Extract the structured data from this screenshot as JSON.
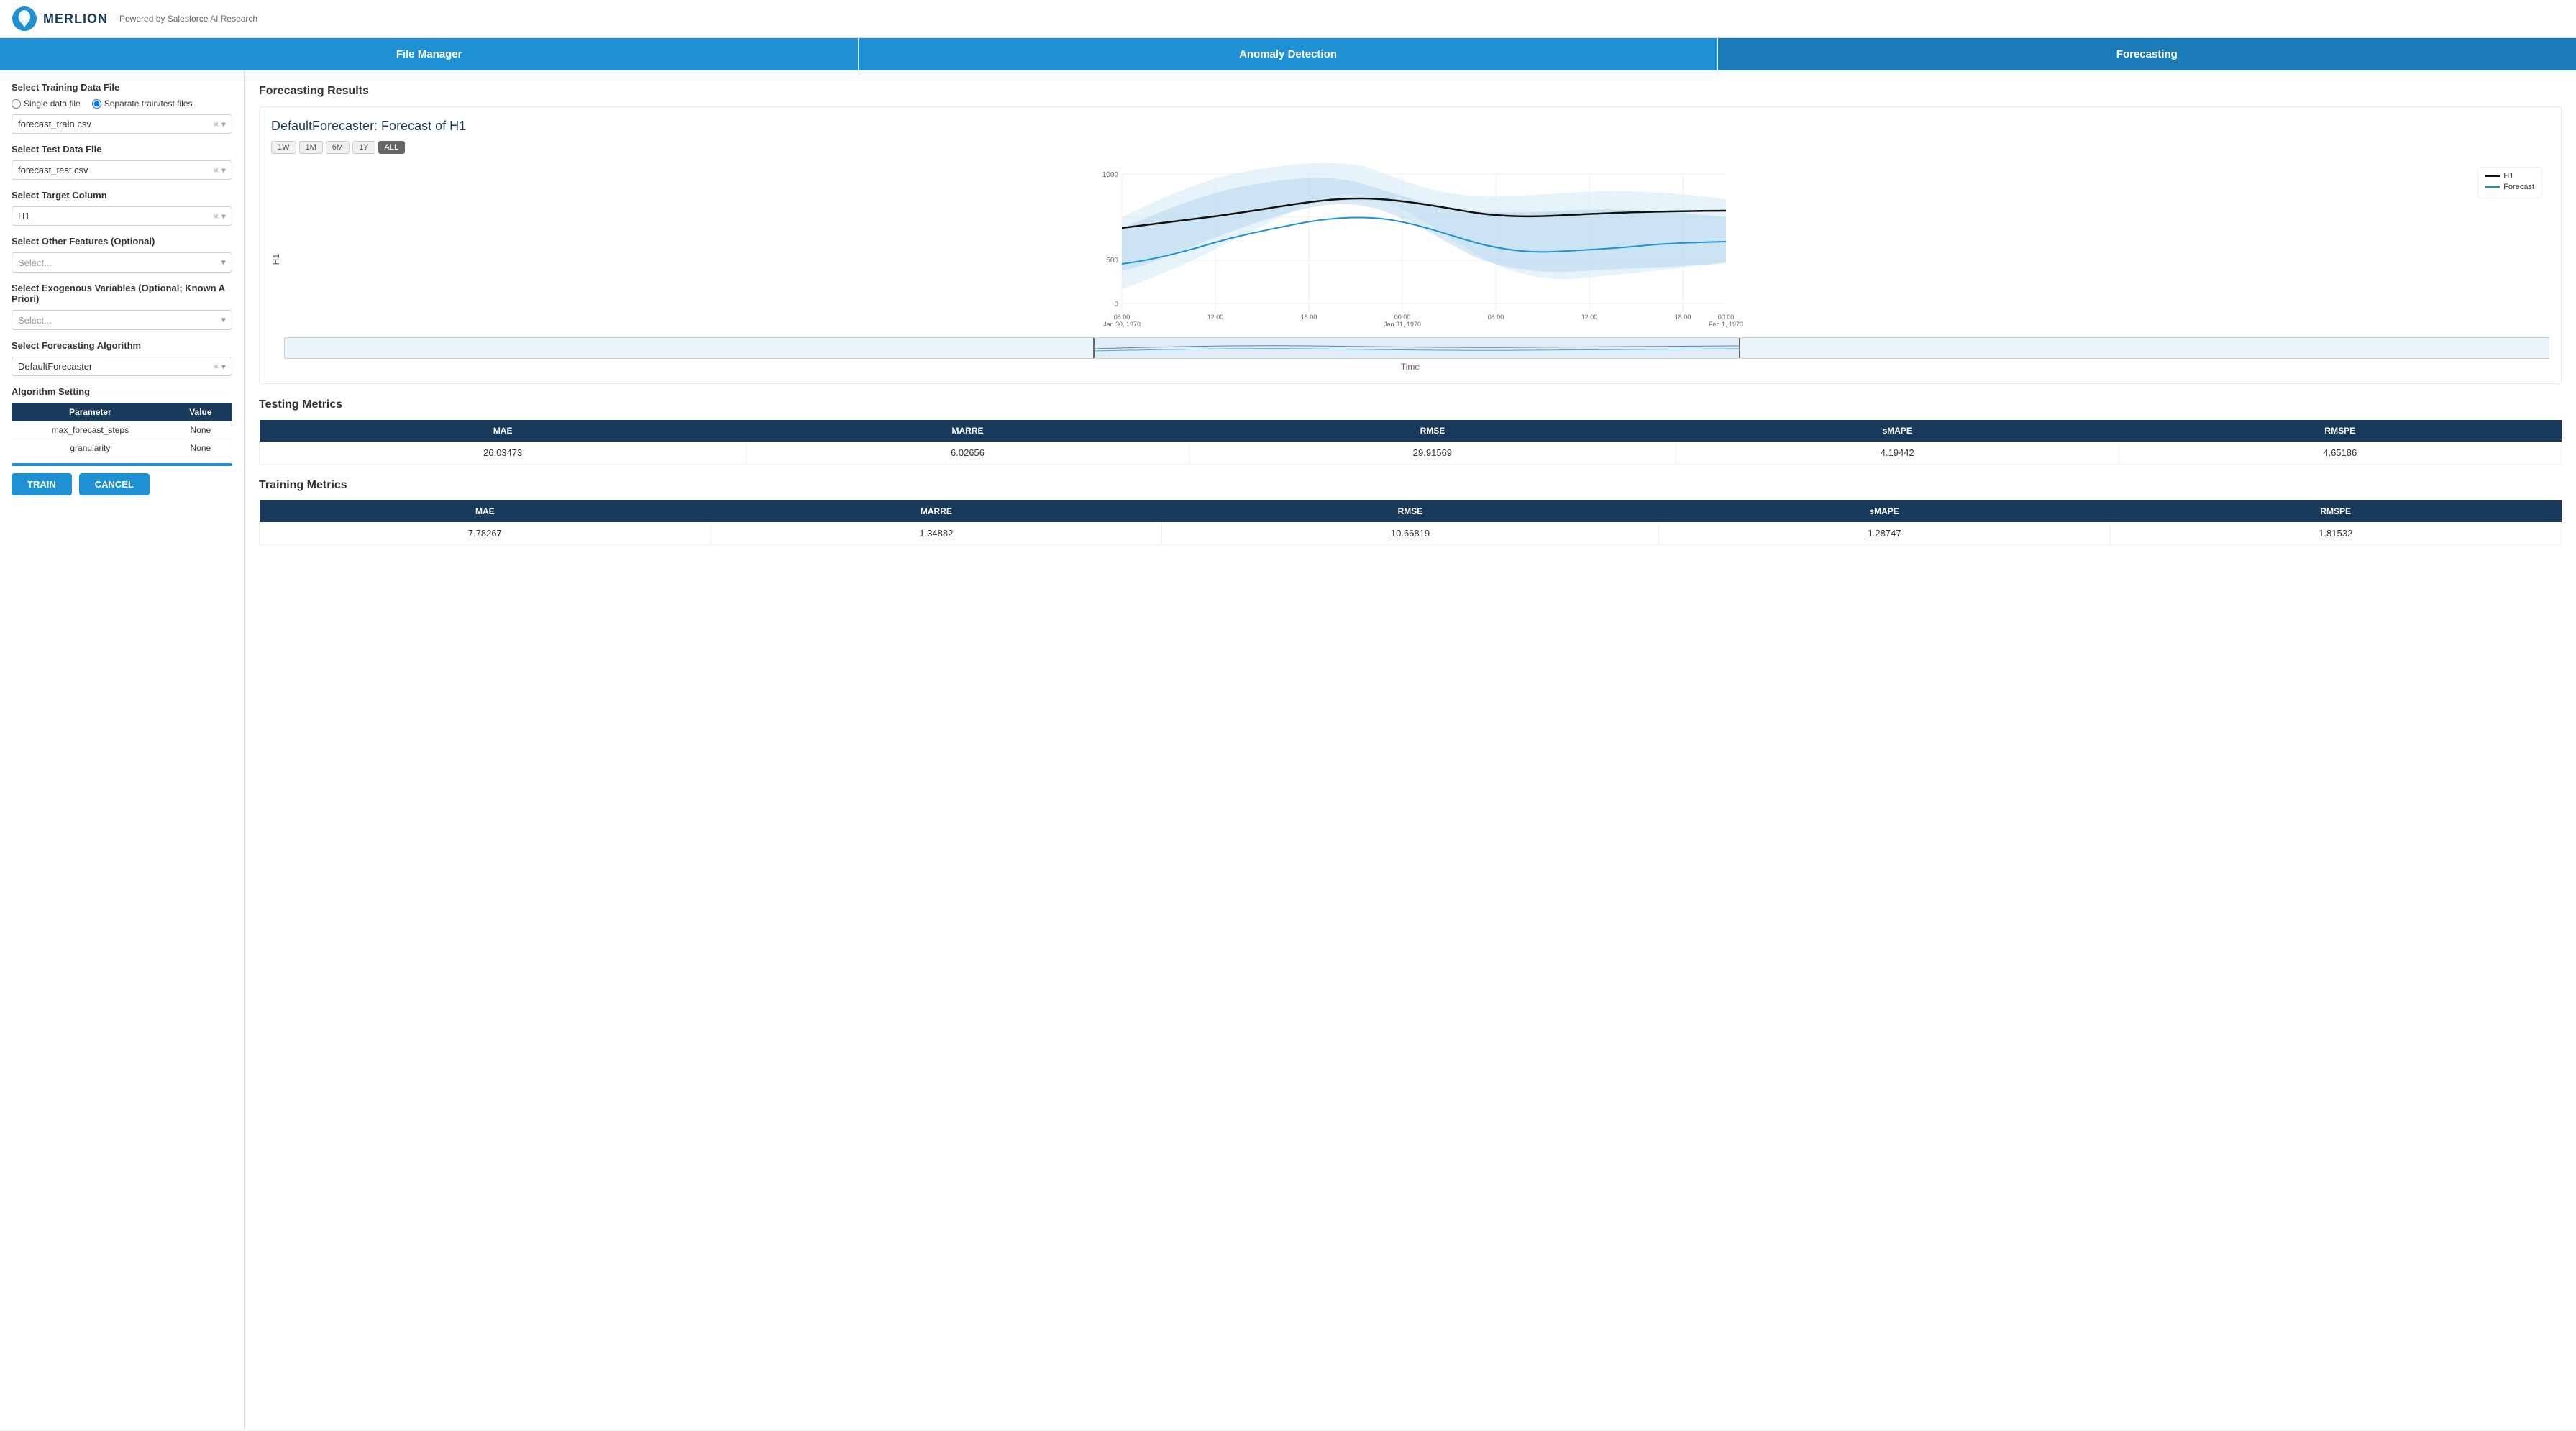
{
  "header": {
    "logo_text": "MERLION",
    "powered_by": "Powered by Salesforce AI Research"
  },
  "nav": {
    "items": [
      {
        "label": "File Manager",
        "active": false
      },
      {
        "label": "Anomaly Detection",
        "active": false
      },
      {
        "label": "Forecasting",
        "active": true
      }
    ]
  },
  "sidebar": {
    "training_file_title": "Select Training Data File",
    "radio_single": "Single data file",
    "radio_separate": "Separate train/test files",
    "training_file_value": "forecast_train.csv",
    "test_file_title": "Select Test Data File",
    "test_file_value": "forecast_test.csv",
    "target_column_title": "Select Target Column",
    "target_column_value": "H1",
    "other_features_title": "Select Other Features (Optional)",
    "other_features_placeholder": "Select...",
    "exogenous_title": "Select Exogenous Variables (Optional; Known A Priori)",
    "exogenous_placeholder": "Select...",
    "algorithm_title": "Select Forecasting Algorithm",
    "algorithm_value": "DefaultForecaster",
    "algo_setting_title": "Algorithm Setting",
    "algo_table_headers": [
      "Parameter",
      "Value"
    ],
    "algo_table_rows": [
      {
        "parameter": "max_forecast_steps",
        "value": "None"
      },
      {
        "parameter": "granularity",
        "value": "None"
      }
    ],
    "train_btn": "TRAIN",
    "cancel_btn": "CANCEL"
  },
  "content": {
    "forecasting_results_title": "Forecasting Results",
    "chart_title": "DefaultForecaster: Forecast of H1",
    "time_buttons": [
      "1W",
      "1M",
      "6M",
      "1Y",
      "ALL"
    ],
    "active_time_btn": "ALL",
    "x_axis_label": "Time",
    "y_axis_label": "H1",
    "x_ticks": [
      "06:00\nJan 30, 1970",
      "12:00",
      "18:00",
      "00:00\nJan 31, 1970",
      "06:00",
      "12:00",
      "18:00",
      "00:00\nFeb 1, 1970"
    ],
    "y_ticks": [
      "0",
      "500",
      "1000"
    ],
    "legend": [
      {
        "label": "H1",
        "color": "#000000"
      },
      {
        "label": "Forecast",
        "color": "#1e90d4"
      }
    ],
    "testing_metrics_title": "Testing Metrics",
    "testing_metrics_headers": [
      "MAE",
      "MARRE",
      "RMSE",
      "sMAPE",
      "RMSPE"
    ],
    "testing_metrics_row": [
      "26.03473",
      "6.02656",
      "29.91569",
      "4.19442",
      "4.65186"
    ],
    "training_metrics_title": "Training Metrics",
    "training_metrics_headers": [
      "MAE",
      "MARRE",
      "RMSE",
      "sMAPE",
      "RMSPE"
    ],
    "training_metrics_row": [
      "7.78267",
      "1.34882",
      "10.66819",
      "1.28747",
      "1.81532"
    ]
  }
}
